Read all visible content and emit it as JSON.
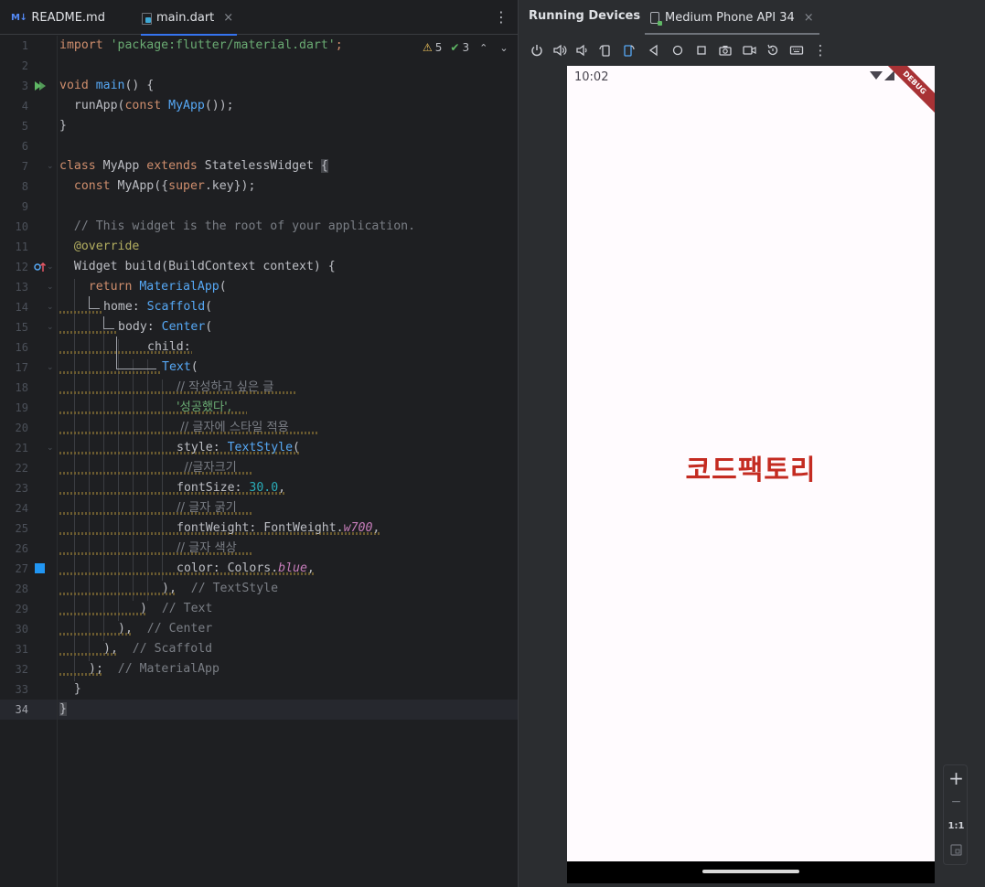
{
  "editor": {
    "tabs": [
      {
        "label": "README.md",
        "icon": "markdown-icon",
        "icon_text": "M↓"
      },
      {
        "label": "main.dart",
        "icon": "dart-file-icon"
      }
    ],
    "close_glyph": "×",
    "more_glyph": "⋮",
    "inspections": {
      "warnings": "5",
      "weak_warnings": "3"
    },
    "current_line": 34,
    "line_numbers": [
      "1",
      "2",
      "3",
      "4",
      "5",
      "6",
      "7",
      "8",
      "9",
      "10",
      "11",
      "12",
      "13",
      "14",
      "15",
      "16",
      "17",
      "18",
      "19",
      "20",
      "21",
      "22",
      "23",
      "24",
      "25",
      "26",
      "27",
      "28",
      "29",
      "30",
      "31",
      "32",
      "33",
      "34"
    ],
    "code": {
      "l1_kw": "import",
      "l1_str": "'package:flutter/material.dart'",
      "l1_end": ";",
      "l3_kw": "void",
      "l3_fn": "main",
      "l3_end": "() {",
      "l4_a": "  runApp(",
      "l4_kw": "const",
      "l4_cls": "MyApp",
      "l4_end": "());",
      "l5": "}",
      "l7_kw1": "class",
      "l7_a": " MyApp ",
      "l7_kw2": "extends",
      "l7_b": " StatelessWidget ",
      "l7_brace": "{",
      "l8_kw": "const",
      "l8_a": " MyApp({",
      "l8_kw2": "super",
      "l8_b": ".key});",
      "l10": "// This widget is the root of your application.",
      "l11": "@override",
      "l12": "Widget build(BuildContext context) {",
      "l13_kw": "return",
      "l13_cls": "MaterialApp",
      "l13_end": "(",
      "l14_a": "home: ",
      "l14_cls": "Scaffold",
      "l14_end": "(",
      "l15_a": "body: ",
      "l15_cls": "Center",
      "l15_end": "(",
      "l16": "child:",
      "l17_cls": "Text",
      "l17_end": "(",
      "l18": "// 작성하고 싶은 글",
      "l19": "'성공했다',",
      "l20": " // 글자에 스타일 적용",
      "l21_a": "style: ",
      "l21_cls": "TextStyle",
      "l21_end": "(",
      "l22": "  //글자크기",
      "l23_a": "fontSize: ",
      "l23_num": "30.0",
      "l23_end": ",",
      "l24": "// 글자 굵기",
      "l25_a": "fontWeight: FontWeight.",
      "l25_it": "w700",
      "l25_end": ",",
      "l26": "// 글자 색상",
      "l27_a": "color: Colors.",
      "l27_it": "blue",
      "l27_end": ",",
      "l28_a": "),",
      "l28_cm": "// TextStyle",
      "l29_a": ")",
      "l29_cm": "// Text",
      "l30_a": "),",
      "l30_cm": "// Center",
      "l31_a": "),",
      "l31_cm": "// Scaffold",
      "l32_a": ");",
      "l32_cm": "// MaterialApp",
      "l33": "}",
      "l34": "}"
    }
  },
  "devices": {
    "title": "Running Devices",
    "tab_label": "Medium Phone API 34",
    "close_glyph": "×",
    "toolbar_icons": [
      "power-icon",
      "volume-up-icon",
      "volume-down-icon",
      "rotate-left-icon",
      "rotate-right-icon",
      "back-icon",
      "home-icon",
      "overview-icon",
      "screenshot-icon",
      "screen-record-icon",
      "reset-icon",
      "keyboard-icon",
      "more-icon"
    ],
    "phone": {
      "time": "10:02",
      "debug_banner": "DEBUG",
      "app_text": "코드팩토리",
      "app_text_color": "#c42b21"
    },
    "zoom": {
      "in": "+",
      "out": "−",
      "actual": "1:1"
    }
  },
  "colors": {
    "accent": "#3574f0",
    "editor_bg": "#1e1f22",
    "panel_bg": "#2b2d30"
  }
}
